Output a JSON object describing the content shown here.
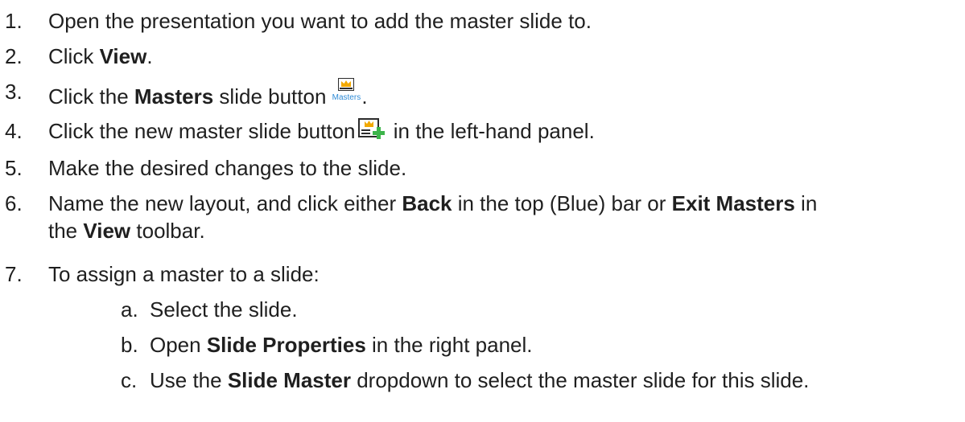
{
  "steps": [
    {
      "num": "1.",
      "text": "Open the presentation you want to add the master slide to."
    },
    {
      "num": "2.",
      "pre": "Click ",
      "bold": "View",
      "post": "."
    },
    {
      "num": "3.",
      "pre": "Click the ",
      "bold": "Masters",
      "post": " slide button",
      "icon_label": "Masters",
      "end": "."
    },
    {
      "num": "4.",
      "pre": "Click the new master slide button",
      "post": " in the left-hand panel."
    },
    {
      "num": "5.",
      "text": "Make the desired changes to the slide."
    },
    {
      "num": "6.",
      "pre": "Name the new layout, and click either ",
      "bold1": "Back",
      "mid": " in the top (Blue) bar or ",
      "bold2": "Exit Masters",
      "mid2": " in",
      "line2_pre": "the ",
      "bold3": "View",
      "line2_post": " toolbar."
    },
    {
      "num": "7.",
      "text": "To assign a master to a slide:"
    }
  ],
  "substeps": [
    {
      "num": "a.",
      "text": "Select the slide."
    },
    {
      "num": "b.",
      "pre": "Open ",
      "bold": "Slide Properties",
      "post": " in the right panel."
    },
    {
      "num": "c.",
      "pre": "Use the ",
      "bold": "Slide Master",
      "post": " dropdown to select the master slide for this slide."
    }
  ],
  "icons": {
    "masters": "masters-slide-button-icon",
    "new_master": "new-master-slide-icon"
  },
  "colors": {
    "text": "#1f1f1f",
    "masters_label": "#2f8bd6",
    "crown": "#f2a900",
    "plus": "#3cb44a"
  }
}
